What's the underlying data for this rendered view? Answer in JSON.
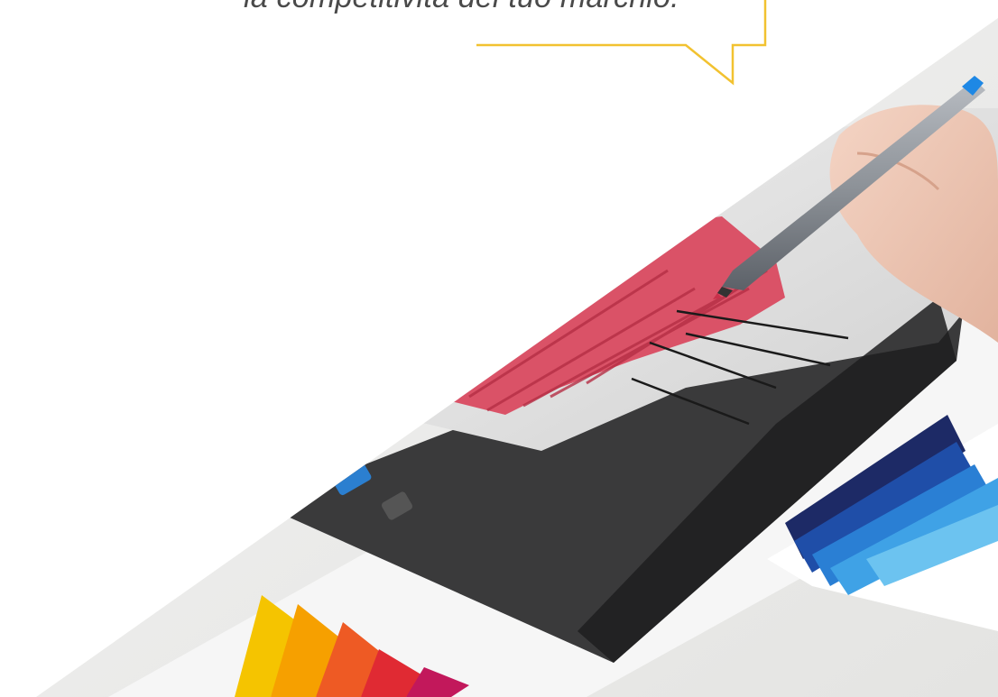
{
  "quote": {
    "text": "la competitività del tuo marchio."
  },
  "colors": {
    "accent_yellow": "#f2c230",
    "text_gray": "#4a4a4a",
    "background": "#ffffff"
  },
  "photo": {
    "subject": "hand-drawing-on-tablet-with-stylus",
    "tablet-screen-art": "red-umbrella-sketch",
    "props": [
      "pantone-blue-swatches",
      "rainbow-color-fan"
    ]
  }
}
